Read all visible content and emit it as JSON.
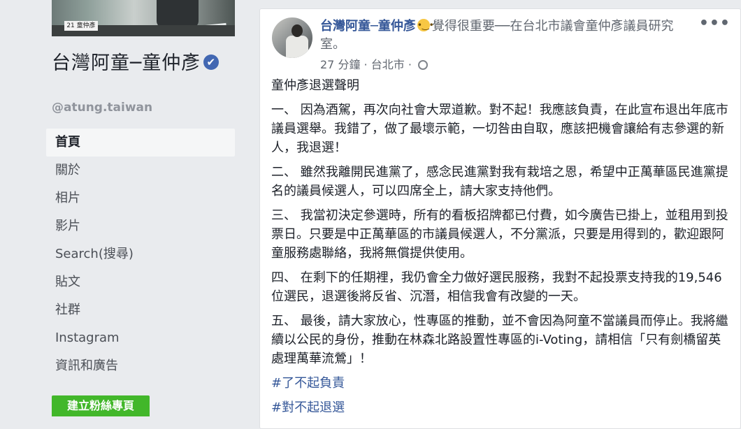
{
  "sidebar": {
    "cover_plate": "21 童仲彥",
    "page_name": "台灣阿童─童仲彥",
    "verified_mark": "✔",
    "handle": "@atung.taiwan",
    "nav": [
      "首頁",
      "關於",
      "相片",
      "影片",
      "Search(搜尋)",
      "貼文",
      "社群",
      "Instagram",
      "資訊和廣告"
    ],
    "cta": "建立粉絲專頁"
  },
  "post": {
    "poster": "台灣阿童─童仲彥",
    "feeling": "覺得很重要──在台北市議會童仲彥議員研究室。",
    "time": "27 分鐘",
    "location": "台北市",
    "privacy_icon": "globe-icon",
    "more_icon": "ellipsis-icon",
    "title": "童仲彥退選聲明",
    "paragraphs": [
      "一、 因為酒駕，再次向社會大眾道歉。對不起！我應該負責，在此宣布退出年底市議員選舉。我錯了，做了最壞示範，一切咎由自取，應該把機會讓給有志參選的新人，我退選！",
      "二、 雖然我離開民進黨了，感念民進黨對我有栽培之恩，希望中正萬華區民進黨提名的議員候選人，可以四席全上，請大家支持他們。",
      "三、 我當初決定參選時，所有的看板招牌都已付費，如今廣告已掛上，並租用到投票日。只要是中正萬華區的市議員候選人，不分黨派，只要是用得到的，歡迎跟阿童服務處聯絡，我將無償提供使用。",
      "四、 在剩下的任期裡，我仍會全力做好選民服務，我對不起投票支持我的19,546位選民，退選後將反省、沉潛，相信我會有改變的一天。",
      "五、 最後，請大家放心，性專區的推動，並不會因為阿童不當議員而停止。我將繼續以公民的身份，推動在林森北路設置性專區的i-Voting，請相信「只有劍橋留英 處理萬華流鶯」！"
    ],
    "hashtags": [
      "#了不起負責",
      "#對不起退選"
    ]
  }
}
